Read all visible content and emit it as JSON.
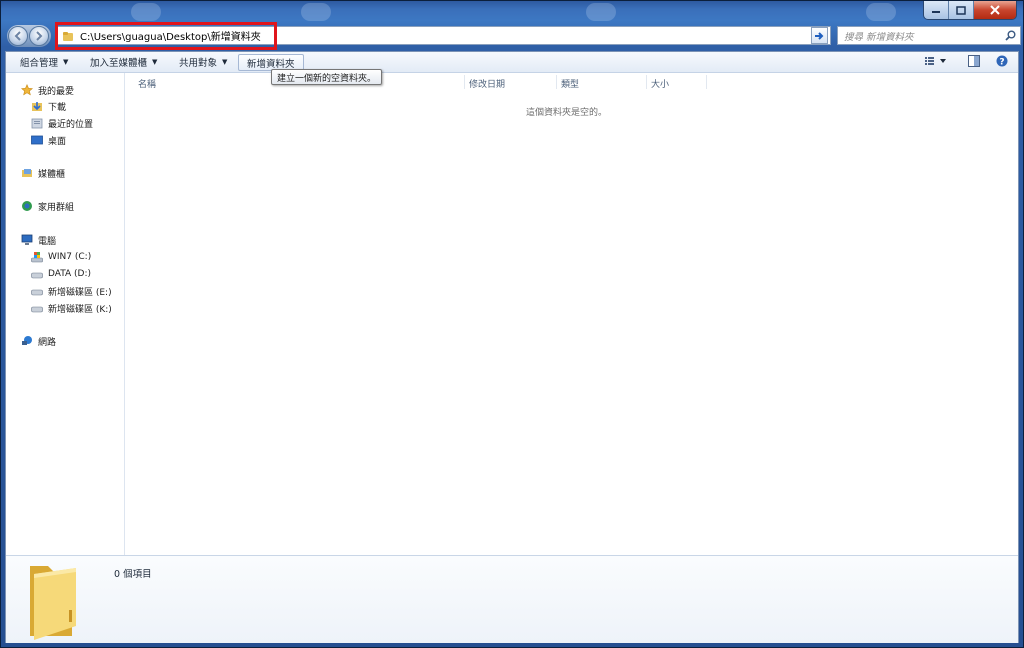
{
  "window": {
    "address_path": "C:\\Users\\guagua\\Desktop\\新增資料夾",
    "search_placeholder": "搜尋 新增資料夾"
  },
  "toolbar": {
    "organize": "組合管理",
    "add_to_library": "加入至媒體櫃",
    "share_with": "共用對象",
    "new_folder": "新增資料夾",
    "tooltip": "建立一個新的空資料夾。"
  },
  "nav": {
    "favorites": "我的最愛",
    "downloads": "下載",
    "recent": "最近的位置",
    "desktop": "桌面",
    "libraries": "媒體櫃",
    "homegroup": "家用群組",
    "computer": "電腦",
    "drive_c": "WIN7 (C:)",
    "drive_d": "DATA (D:)",
    "drive_e": "新增磁碟區 (E:)",
    "drive_k": "新增磁碟區 (K:)",
    "network": "網路"
  },
  "columns": {
    "name": "名稱",
    "modified": "修改日期",
    "type": "類型",
    "size": "大小"
  },
  "list": {
    "empty_message": "這個資料夾是空的。"
  },
  "details": {
    "item_count": "0 個項目"
  },
  "colors": {
    "highlight_box": "#e0151c",
    "title_gradient_top": "#2d5aa0",
    "content_bg": "#ffffff"
  }
}
